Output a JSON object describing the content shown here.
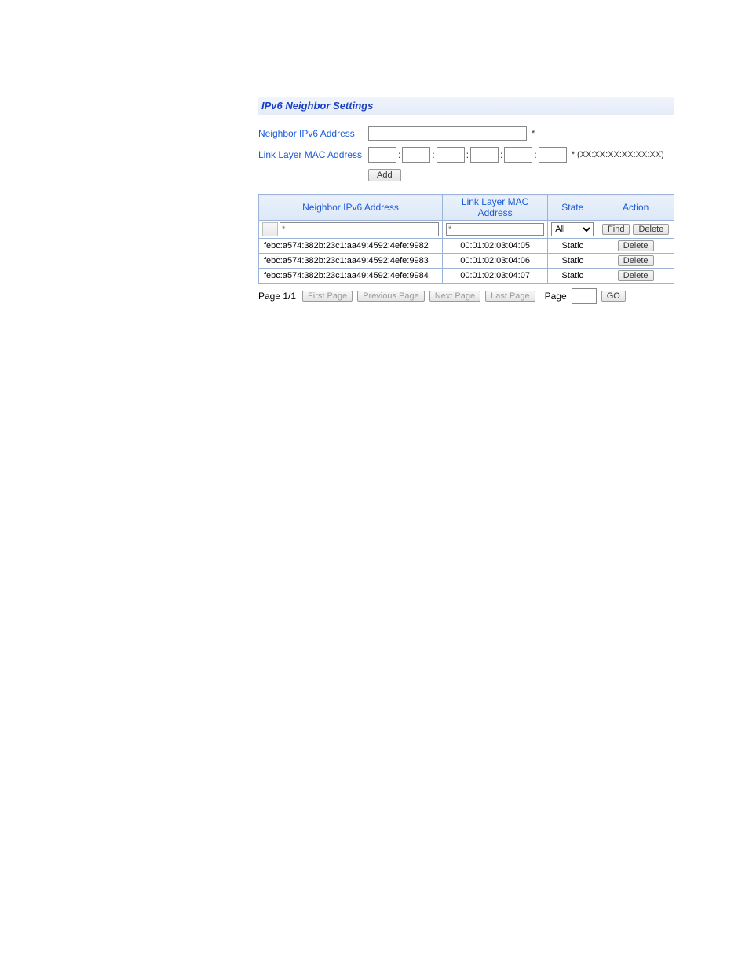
{
  "title": "IPv6 Neighbor Settings",
  "form": {
    "ipv6_label": "Neighbor IPv6 Address",
    "ipv6_value": "",
    "ipv6_required_mark": "*",
    "mac_label": "Link Layer MAC Address",
    "mac_segments": [
      "",
      "",
      "",
      "",
      "",
      ""
    ],
    "mac_hint": "* (XX:XX:XX:XX:XX:XX)",
    "add_button": "Add"
  },
  "table": {
    "headers": {
      "ipv6": "Neighbor IPv6 Address",
      "mac": "Link Layer MAC Address",
      "state": "State",
      "action": "Action"
    },
    "filter": {
      "ipv6_placeholder": "*",
      "mac_placeholder": "*",
      "state_selected": "All",
      "state_options": [
        "All"
      ],
      "find_button": "Find",
      "delete_button": "Delete"
    },
    "rows": [
      {
        "ipv6": "febc:a574:382b:23c1:aa49:4592:4efe:9982",
        "mac": "00:01:02:03:04:05",
        "state": "Static",
        "action": "Delete"
      },
      {
        "ipv6": "febc:a574:382b:23c1:aa49:4592:4efe:9983",
        "mac": "00:01:02:03:04:06",
        "state": "Static",
        "action": "Delete"
      },
      {
        "ipv6": "febc:a574:382b:23c1:aa49:4592:4efe:9984",
        "mac": "00:01:02:03:04:07",
        "state": "Static",
        "action": "Delete"
      }
    ]
  },
  "pagination": {
    "indicator": "Page 1/1",
    "first": "First Page",
    "prev": "Previous Page",
    "next": "Next Page",
    "last": "Last Page",
    "page_label": "Page",
    "page_value": "",
    "go": "GO"
  }
}
